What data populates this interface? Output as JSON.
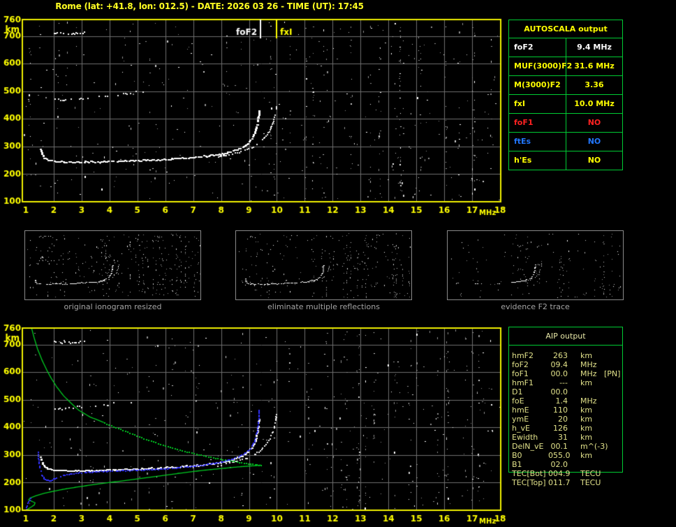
{
  "header": {
    "title": "Rome (lat: +41.8, lon: 012.5) - DATE: 2026 03 26 - TIME (UT): 17:45"
  },
  "autoscala": {
    "header": "AUTOSCALA output",
    "rows": [
      {
        "param": "foF2",
        "value": "9.4 MHz",
        "color": "#ffffff"
      },
      {
        "param": "MUF(3000)F2",
        "value": "31.6 MHz",
        "color": "#ffff00"
      },
      {
        "param": "M(3000)F2",
        "value": "3.36",
        "color": "#ffff00"
      },
      {
        "param": "fxI",
        "value": "10.0 MHz",
        "color": "#ffff00"
      },
      {
        "param": "foF1",
        "value": "NO",
        "color": "#ff2222"
      },
      {
        "param": "ftEs",
        "value": "NO",
        "color": "#2277ff"
      },
      {
        "param": "h'Es",
        "value": "NO",
        "color": "#ffff00"
      }
    ]
  },
  "aip": {
    "header": "AIP output",
    "rows": [
      {
        "param": "hmF2",
        "value": "263",
        "unit": "km",
        "note": ""
      },
      {
        "param": "foF2",
        "value": "09.4",
        "unit": "MHz",
        "note": ""
      },
      {
        "param": "foF1",
        "value": "00.0",
        "unit": "MHz",
        "note": "[PN]"
      },
      {
        "param": "hmF1",
        "value": "---",
        "unit": "km",
        "note": ""
      },
      {
        "param": "D1",
        "value": "00.0",
        "unit": "",
        "note": ""
      },
      {
        "param": "foE",
        "value": "1.4",
        "unit": "MHz",
        "note": ""
      },
      {
        "param": "hmE",
        "value": "110",
        "unit": "km",
        "note": ""
      },
      {
        "param": "ymE",
        "value": "20",
        "unit": "km",
        "note": ""
      },
      {
        "param": "h_vE",
        "value": "126",
        "unit": "km",
        "note": ""
      },
      {
        "param": "Ewidth",
        "value": "31",
        "unit": "km",
        "note": ""
      },
      {
        "param": "DelN_vE",
        "value": "00.1",
        "unit": "m^(-3)",
        "note": ""
      },
      {
        "param": "B0",
        "value": "055.0",
        "unit": "km",
        "note": ""
      },
      {
        "param": "B1",
        "value": "02.0",
        "unit": "",
        "note": ""
      },
      {
        "param": "TEC[Bot]",
        "value": "004.9",
        "unit": "TECU",
        "note": ""
      },
      {
        "param": "TEC[Top]",
        "value": "011.7",
        "unit": "TECU",
        "note": ""
      }
    ]
  },
  "thumbnails": [
    {
      "caption": "original ionogram resized"
    },
    {
      "caption": "eliminate multiple reflections"
    },
    {
      "caption": "evidence F2 trace"
    }
  ],
  "chart_data": {
    "type": "scatter",
    "axes": {
      "x_ticks": [
        "1",
        "2",
        "3",
        "4",
        "5",
        "6",
        "7",
        "8",
        "9",
        "10",
        "11",
        "12",
        "13",
        "14",
        "15",
        "16",
        "17",
        "18"
      ],
      "x_unit": "MHz",
      "y_ticks": [
        760,
        700,
        600,
        500,
        400,
        300,
        200,
        100
      ],
      "y_unit": "km",
      "xlim": [
        1,
        18.2
      ],
      "ylim": [
        100,
        760
      ],
      "grid": true,
      "grid_color": "#6f6f6f",
      "frame_color": "#f0f000",
      "tick_color": "#ffff00"
    },
    "shared_traces": [
      {
        "name": "multi-700",
        "color": "#ffffff",
        "style": "stamp",
        "w": 2,
        "h": 2,
        "step": 2.4,
        "skip": 0.3,
        "jy": 1.4,
        "points": [
          [
            2.02,
            712
          ],
          [
            2.25,
            709
          ],
          [
            2.5,
            707
          ],
          [
            2.75,
            707
          ],
          [
            2.95,
            710
          ],
          [
            3.1,
            714
          ]
        ]
      },
      {
        "name": "multi-470",
        "color": "#f2f2f2",
        "style": "stamp",
        "w": 2,
        "h": 2,
        "step": 3.0,
        "skip": 0.42,
        "fade": 0.3,
        "jy": 1.6,
        "points": [
          [
            2.05,
            467
          ],
          [
            2.5,
            471
          ],
          [
            3.0,
            474
          ],
          [
            3.5,
            478
          ],
          [
            4.0,
            483
          ],
          [
            4.5,
            489
          ],
          [
            4.9,
            495
          ],
          [
            5.2,
            500
          ]
        ]
      },
      {
        "name": "main-o",
        "color": "#ffffff",
        "style": "stamp",
        "w": 3,
        "h": 2,
        "step": 2.2,
        "skip": 0.1,
        "jy": 0.9,
        "points": [
          [
            1.55,
            290
          ],
          [
            1.6,
            272
          ],
          [
            1.68,
            258
          ],
          [
            1.8,
            250
          ],
          [
            2.0,
            246
          ],
          [
            2.4,
            243
          ],
          [
            3.0,
            243
          ],
          [
            3.7,
            245
          ],
          [
            4.4,
            247
          ],
          [
            5.1,
            249
          ],
          [
            5.8,
            252
          ],
          [
            6.4,
            256
          ],
          [
            7.0,
            260
          ],
          [
            7.5,
            265
          ],
          [
            8.0,
            272
          ],
          [
            8.4,
            281
          ],
          [
            8.7,
            293
          ],
          [
            8.95,
            308
          ],
          [
            9.12,
            328
          ],
          [
            9.24,
            352
          ],
          [
            9.31,
            380
          ],
          [
            9.35,
            405
          ],
          [
            9.37,
            428
          ]
        ]
      },
      {
        "name": "main-x",
        "color": "#efefef",
        "style": "stamp",
        "w": 2,
        "h": 2,
        "step": 2.6,
        "skip": 0.28,
        "jy": 0.8,
        "points": [
          [
            7.9,
            262
          ],
          [
            8.3,
            270
          ],
          [
            8.7,
            280
          ],
          [
            9.0,
            291
          ],
          [
            9.25,
            304
          ],
          [
            9.45,
            320
          ],
          [
            9.62,
            338
          ],
          [
            9.76,
            360
          ],
          [
            9.86,
            385
          ],
          [
            9.93,
            410
          ],
          [
            9.97,
            432
          ],
          [
            9.99,
            445
          ]
        ]
      }
    ],
    "top_ionogram": {
      "show": [
        "multi-700",
        "multi-470",
        "main-o",
        "main-x"
      ],
      "markers": [
        {
          "f": 9.4,
          "label": "foF2",
          "color": "#ffffff",
          "align": "right"
        },
        {
          "f": 10.0,
          "label": "fxI",
          "color": "#ffff00",
          "align": "left"
        }
      ],
      "noise": {
        "seed": 20260326,
        "uniform": 310,
        "column_groups": [
          {
            "fmin": 9.7,
            "fmax": 18.1,
            "cols": 24,
            "dots_min": 4,
            "dots_max": 16
          },
          {
            "fmin": 1.05,
            "fmax": 9.7,
            "cols": 12,
            "dots_min": 3,
            "dots_max": 8
          }
        ]
      }
    },
    "thumbs": [
      {
        "show": [
          "multi-700",
          "multi-470",
          "main-o",
          "main-x"
        ],
        "noise": {
          "seed": 101,
          "uniform": 150,
          "column_groups": [
            {
              "fmin": 7.8,
              "fmax": 18.1,
              "cols": 34,
              "dots_min": 2,
              "dots_max": 8
            },
            {
              "fmin": 1.0,
              "fmax": 7.8,
              "cols": 8,
              "dots_min": 2,
              "dots_max": 4
            }
          ]
        }
      },
      {
        "show": [
          {
            "name": "multi-700",
            "fmax": 2.6
          },
          "main-o",
          "main-x"
        ],
        "noise": {
          "seed": 202,
          "uniform": 130,
          "column_groups": [
            {
              "fmin": 7.8,
              "fmax": 18.1,
              "cols": 30,
              "dots_min": 2,
              "dots_max": 8
            },
            {
              "fmin": 1.0,
              "fmax": 7.8,
              "cols": 6,
              "dots_min": 2,
              "dots_max": 4
            }
          ]
        }
      },
      {
        "show": [
          {
            "name": "main-o",
            "fmin": 6.6
          },
          {
            "name": "main-x",
            "fmin": 8.55
          }
        ],
        "traces": [
          {
            "name": "p3-d1",
            "color": "#ffffff",
            "style": "stamp",
            "w": 2,
            "h": 1,
            "step": 2,
            "skip": 0.3,
            "points": [
              [
                3.35,
                247
              ],
              [
                3.65,
                246
              ]
            ]
          },
          {
            "name": "p3-d2",
            "color": "#ffffff",
            "style": "stamp",
            "w": 2,
            "h": 1,
            "step": 2,
            "skip": 0.3,
            "points": [
              [
                4.0,
                245
              ],
              [
                4.15,
                244
              ]
            ]
          },
          {
            "name": "p3-d3",
            "color": "#ffffff",
            "style": "stamp",
            "w": 2,
            "h": 1,
            "step": 2,
            "skip": 0.35,
            "points": [
              [
                5.6,
                250
              ],
              [
                5.8,
                250
              ]
            ]
          },
          {
            "name": "p3-d4",
            "color": "#ffffff",
            "style": "stamp",
            "w": 2,
            "h": 1,
            "step": 2,
            "skip": 0.35,
            "points": [
              [
                1.45,
                253
              ],
              [
                1.62,
                252
              ]
            ]
          }
        ],
        "noise": {
          "seed": 303,
          "uniform": 75,
          "column_groups": [
            {
              "fmin": 7.5,
              "fmax": 18.1,
              "cols": 22,
              "dots_min": 2,
              "dots_max": 6
            },
            {
              "fmin": 1.0,
              "fmax": 7.5,
              "cols": 5,
              "dots_min": 1,
              "dots_max": 3
            }
          ]
        }
      }
    ],
    "bottom_ionogram": {
      "show": [
        "multi-700",
        "multi-470",
        "main-o",
        "main-x"
      ],
      "traces": [
        {
          "name": "profile-top-solid",
          "color": "#00cc22",
          "style": "line",
          "width": 1.3,
          "points": [
            [
              1.2,
              762
            ],
            [
              1.3,
              724
            ],
            [
              1.42,
              684
            ],
            [
              1.58,
              644
            ],
            [
              1.75,
              608
            ],
            [
              1.9,
              580
            ],
            [
              2.1,
              548
            ],
            [
              2.35,
              515
            ],
            [
              2.6,
              490
            ],
            [
              2.9,
              462
            ],
            [
              3.3,
              438
            ],
            [
              3.8,
              418
            ]
          ]
        },
        {
          "name": "profile-top-dotted",
          "color": "#00cc22",
          "style": "dots",
          "w": 2,
          "step": 4,
          "points": [
            [
              3.8,
              418
            ],
            [
              4.3,
              398
            ],
            [
              4.8,
              378
            ],
            [
              5.3,
              358
            ],
            [
              5.9,
              338
            ],
            [
              6.5,
              320
            ],
            [
              7.1,
              305
            ],
            [
              7.7,
              292
            ],
            [
              8.3,
              281
            ],
            [
              8.8,
              273
            ],
            [
              9.2,
              267
            ],
            [
              9.42,
              264
            ]
          ]
        },
        {
          "name": "profile-bottom",
          "color": "#00cc22",
          "style": "line",
          "width": 1.3,
          "points": [
            [
              1.02,
              100
            ],
            [
              1.1,
              106
            ],
            [
              1.2,
              112
            ],
            [
              1.3,
              119
            ],
            [
              1.33,
              127
            ],
            [
              1.2,
              133
            ],
            [
              1.1,
              137
            ],
            [
              1.15,
              144
            ],
            [
              1.35,
              152
            ],
            [
              1.6,
              160
            ],
            [
              1.95,
              168
            ],
            [
              2.4,
              177
            ],
            [
              2.9,
              185
            ],
            [
              3.5,
              194
            ],
            [
              4.2,
              203
            ],
            [
              4.9,
              212
            ],
            [
              5.7,
              223
            ],
            [
              6.5,
              234
            ],
            [
              7.3,
              244
            ],
            [
              8.0,
              251
            ],
            [
              8.6,
              257
            ],
            [
              9.0,
              260
            ],
            [
              9.3,
              262
            ],
            [
              9.42,
              264
            ]
          ]
        },
        {
          "name": "synth-f",
          "color": "#3333ff",
          "style": "stamp",
          "w": 2,
          "h": 2,
          "step": 2.8,
          "skip": 0.05,
          "jx": 0.3,
          "jy": 0.5,
          "points": [
            [
              1.45,
              310
            ],
            [
              1.48,
              275
            ],
            [
              1.52,
              248
            ],
            [
              1.58,
              228
            ],
            [
              1.66,
              215
            ],
            [
              1.76,
              208
            ],
            [
              1.9,
              207
            ],
            [
              2.05,
              214
            ],
            [
              2.3,
              224
            ],
            [
              2.6,
              231
            ],
            [
              3.0,
              236
            ],
            [
              3.5,
              239
            ],
            [
              4.1,
              241
            ],
            [
              4.8,
              244
            ],
            [
              5.5,
              247
            ],
            [
              6.2,
              252
            ],
            [
              6.9,
              258
            ],
            [
              7.5,
              265
            ],
            [
              8.0,
              274
            ],
            [
              8.45,
              286
            ],
            [
              8.8,
              301
            ],
            [
              9.05,
              322
            ],
            [
              9.2,
              348
            ],
            [
              9.3,
              380
            ],
            [
              9.34,
              414
            ],
            [
              9.36,
              445
            ],
            [
              9.37,
              460
            ]
          ]
        },
        {
          "name": "synth-e",
          "color": "#3333ff",
          "style": "stamp",
          "w": 2,
          "h": 2,
          "step": 4,
          "skip": 0.3,
          "jx": 0.4,
          "jy": 0.8,
          "points": [
            [
              1.02,
              103
            ],
            [
              1.05,
              116
            ],
            [
              1.1,
              130
            ],
            [
              1.18,
              143
            ],
            [
              1.28,
              153
            ]
          ]
        }
      ],
      "noise": {
        "seed": 4117,
        "uniform": 295,
        "column_groups": [
          {
            "fmin": 9.7,
            "fmax": 18.1,
            "cols": 24,
            "dots_min": 4,
            "dots_max": 14
          },
          {
            "fmin": 1.05,
            "fmax": 9.7,
            "cols": 11,
            "dots_min": 3,
            "dots_max": 8
          }
        ]
      }
    }
  }
}
